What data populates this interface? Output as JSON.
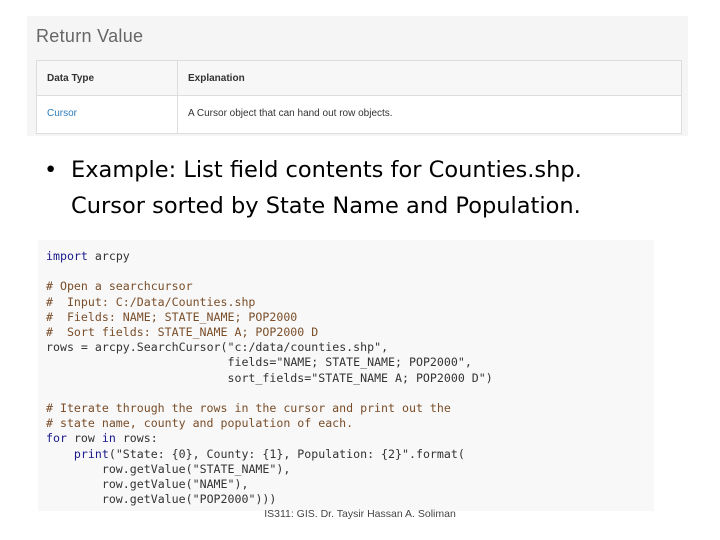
{
  "return_value": {
    "title": "Return Value",
    "headers": [
      "Data Type",
      "Explanation"
    ],
    "row": [
      "Cursor",
      "A Cursor object that can hand out row objects."
    ]
  },
  "bullet": {
    "line1": "Example: List field contents for Counties.shp.",
    "line2": "Cursor sorted by State Name and Population."
  },
  "code_lines": [
    "import arcpy",
    "",
    "# Open a searchcursor",
    "#  Input: C:/Data/Counties.shp",
    "#  Fields: NAME; STATE_NAME; POP2000",
    "#  Sort fields: STATE_NAME A; POP2000 D",
    "rows = arcpy.SearchCursor(\"c:/data/counties.shp\",",
    "                          fields=\"NAME; STATE_NAME; POP2000\",",
    "                          sort_fields=\"STATE_NAME A; POP2000 D\")",
    "",
    "# Iterate through the rows in the cursor and print out the",
    "# state name, county and population of each.",
    "for row in rows:",
    "    print(\"State: {0}, County: {1}, Population: {2}\".format(",
    "        row.getValue(\"STATE_NAME\"),",
    "        row.getValue(\"NAME\"),",
    "        row.getValue(\"POP2000\")))"
  ],
  "footer": "IS311: GIS. Dr. Taysir Hassan A. Soliman"
}
